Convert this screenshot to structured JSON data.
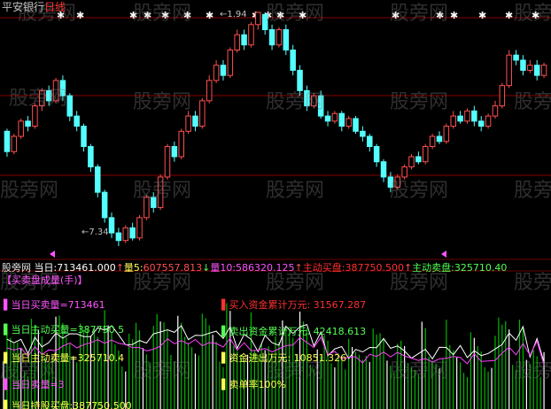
{
  "header": {
    "stock_name": "平安银行",
    "period": "日线"
  },
  "colors": {
    "up": "#ff5050",
    "down": "#54ffff",
    "white": "#ffffff",
    "yellow": "#ffff54",
    "magenta": "#ff54ff",
    "green": "#54ff54",
    "red_line": "#8a0000",
    "vol_green": "#00b800",
    "vol_white": "#ffffff",
    "vol_magenta": "#ff40ff"
  },
  "price_markers": {
    "high": "1.94",
    "low": "7.34"
  },
  "indicator_bar": {
    "name": "股旁网",
    "today_label": "当日:",
    "today_value": "713461.000",
    "vol5_label": "量5:",
    "vol5_value": "607557.813",
    "vol10_label": "量10:",
    "vol10_value": "586320.125",
    "active_buy_label": "主动买盘:",
    "active_buy_value": "387750.500",
    "active_sell_label": "主动卖盘:",
    "active_sell_value": "325710.40"
  },
  "subchart": {
    "title": "买卖盘成量(手)",
    "left_texts": [
      "当日买卖量=713461",
      "当日主动买量=387750.5",
      "当日主动卖量=325710.4",
      "当日卖量=3"
    ],
    "right_texts": [
      "买入资金累计万元: 31567.287",
      "卖出资金累计万元: 42418.613",
      "资金进出万元: 10851.326",
      "卖单率100%"
    ],
    "bottom_text": "当日持股买盘:387750.500"
  },
  "watermark": "股旁网",
  "chart_data": {
    "type": "candlestick",
    "title": "平安银行 日线",
    "price_range": [
      7.34,
      11.94
    ],
    "annotations": [
      "1.94",
      "7.34"
    ],
    "candles": [
      [
        9.6,
        9.2,
        9.65,
        9.1
      ],
      [
        9.2,
        9.5,
        9.55,
        9.15
      ],
      [
        9.5,
        9.8,
        9.85,
        9.45
      ],
      [
        9.8,
        9.7,
        9.9,
        9.6
      ],
      [
        9.7,
        10.1,
        10.15,
        9.65
      ],
      [
        10.1,
        10.4,
        10.45,
        10.0
      ],
      [
        10.4,
        10.2,
        10.5,
        10.1
      ],
      [
        10.2,
        10.6,
        10.65,
        10.15
      ],
      [
        10.6,
        10.3,
        10.7,
        10.2
      ],
      [
        10.3,
        9.9,
        10.35,
        9.8
      ],
      [
        9.9,
        9.7,
        10.0,
        9.6
      ],
      [
        9.7,
        9.3,
        9.75,
        9.2
      ],
      [
        9.3,
        8.9,
        9.35,
        8.8
      ],
      [
        8.9,
        8.4,
        8.95,
        8.3
      ],
      [
        8.4,
        7.9,
        8.45,
        7.8
      ],
      [
        7.9,
        7.6,
        8.0,
        7.5
      ],
      [
        7.6,
        7.45,
        7.7,
        7.34
      ],
      [
        7.45,
        7.7,
        7.75,
        7.4
      ],
      [
        7.7,
        7.5,
        7.8,
        7.45
      ],
      [
        7.5,
        7.9,
        7.95,
        7.45
      ],
      [
        7.9,
        8.3,
        8.35,
        7.85
      ],
      [
        8.3,
        8.1,
        8.4,
        8.0
      ],
      [
        8.1,
        8.7,
        8.75,
        8.05
      ],
      [
        8.7,
        9.3,
        9.35,
        8.65
      ],
      [
        9.3,
        9.1,
        9.4,
        9.0
      ],
      [
        9.1,
        9.6,
        9.65,
        9.05
      ],
      [
        9.6,
        9.9,
        10.0,
        9.55
      ],
      [
        9.9,
        9.7,
        10.0,
        9.6
      ],
      [
        9.7,
        10.2,
        10.25,
        9.65
      ],
      [
        10.2,
        10.6,
        10.7,
        10.15
      ],
      [
        10.6,
        10.9,
        11.0,
        10.55
      ],
      [
        10.9,
        10.7,
        11.0,
        10.6
      ],
      [
        10.7,
        11.2,
        11.25,
        10.65
      ],
      [
        11.2,
        11.5,
        11.6,
        11.15
      ],
      [
        11.5,
        11.3,
        11.6,
        11.2
      ],
      [
        11.3,
        11.7,
        11.75,
        11.25
      ],
      [
        11.7,
        11.94,
        11.94,
        11.6
      ],
      [
        11.9,
        11.6,
        11.94,
        11.5
      ],
      [
        11.6,
        11.3,
        11.7,
        11.2
      ],
      [
        11.3,
        11.6,
        11.65,
        11.25
      ],
      [
        11.6,
        11.2,
        11.7,
        11.1
      ],
      [
        11.2,
        10.8,
        11.3,
        10.7
      ],
      [
        10.8,
        10.4,
        10.9,
        10.3
      ],
      [
        10.4,
        10.1,
        10.5,
        10.0
      ],
      [
        10.1,
        10.3,
        10.35,
        10.05
      ],
      [
        10.3,
        9.9,
        10.4,
        9.85
      ],
      [
        9.9,
        9.8,
        10.0,
        9.7
      ],
      [
        9.8,
        9.95,
        10.0,
        9.75
      ],
      [
        9.95,
        9.7,
        10.0,
        9.6
      ],
      [
        9.7,
        9.85,
        9.9,
        9.65
      ],
      [
        9.85,
        9.6,
        9.9,
        9.55
      ],
      [
        9.6,
        9.5,
        9.7,
        9.4
      ],
      [
        9.5,
        9.3,
        9.55,
        9.2
      ],
      [
        9.3,
        9.0,
        9.35,
        8.9
      ],
      [
        9.0,
        8.7,
        9.05,
        8.6
      ],
      [
        8.7,
        8.5,
        8.8,
        8.4
      ],
      [
        8.5,
        8.7,
        8.75,
        8.45
      ],
      [
        8.7,
        8.9,
        8.95,
        8.65
      ],
      [
        8.9,
        9.1,
        9.15,
        8.85
      ],
      [
        9.1,
        9.0,
        9.2,
        8.95
      ],
      [
        9.0,
        9.3,
        9.35,
        8.95
      ],
      [
        9.3,
        9.5,
        9.55,
        9.25
      ],
      [
        9.5,
        9.4,
        9.6,
        9.35
      ],
      [
        9.4,
        9.7,
        9.75,
        9.35
      ],
      [
        9.7,
        9.9,
        10.0,
        9.65
      ],
      [
        9.9,
        9.8,
        10.0,
        9.75
      ],
      [
        9.8,
        10.0,
        10.05,
        9.75
      ],
      [
        10.0,
        9.8,
        10.1,
        9.7
      ],
      [
        9.8,
        9.7,
        9.9,
        9.6
      ],
      [
        9.7,
        9.9,
        9.95,
        9.65
      ],
      [
        9.9,
        10.1,
        10.2,
        9.85
      ],
      [
        10.1,
        10.5,
        10.55,
        10.05
      ],
      [
        10.5,
        11.1,
        11.2,
        10.45
      ],
      [
        11.1,
        11.0,
        11.2,
        10.9
      ],
      [
        11.0,
        10.8,
        11.1,
        10.7
      ],
      [
        10.8,
        10.9,
        11.0,
        10.75
      ],
      [
        10.9,
        10.7,
        11.0,
        10.6
      ],
      [
        10.7,
        10.9,
        10.95,
        10.65
      ]
    ],
    "volume_panel": {
      "title": "买卖盘成量(手)",
      "today_volume": 713461,
      "vol5": 607557.813,
      "vol10": 586320.125,
      "active_buy": 387750.5,
      "active_sell": 325710.4
    }
  }
}
